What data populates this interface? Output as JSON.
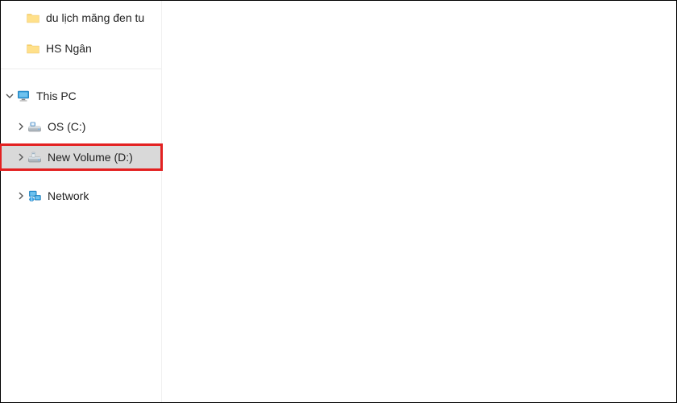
{
  "sidebar": {
    "quick_access": [
      {
        "label": "du lịch măng đen tu"
      },
      {
        "label": "HS Ngân"
      }
    ],
    "this_pc": {
      "label": "This PC",
      "drives": [
        {
          "label": "OS (C:)"
        },
        {
          "label": "New Volume (D:)"
        }
      ]
    },
    "network": {
      "label": "Network"
    }
  }
}
